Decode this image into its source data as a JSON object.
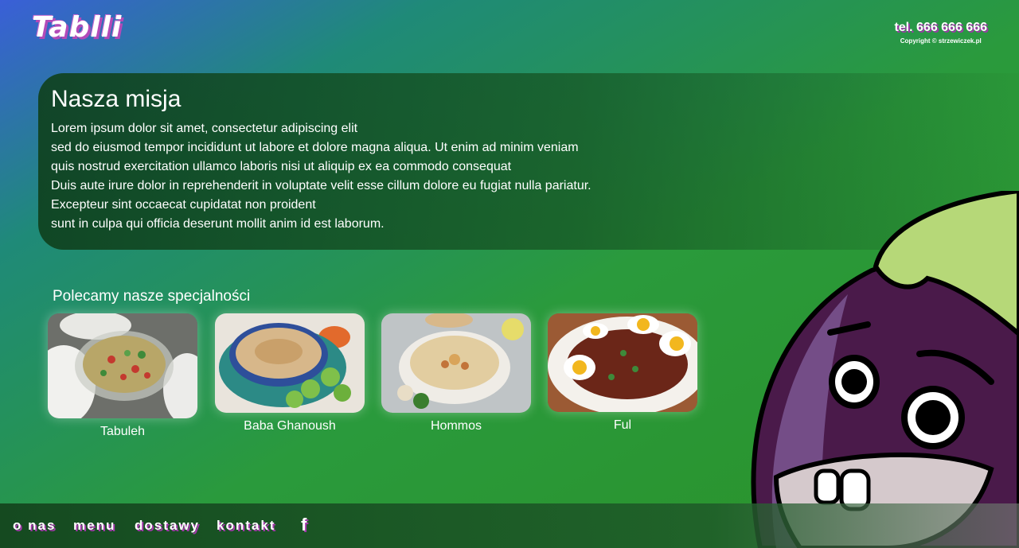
{
  "header": {
    "logo_text": "Tablli",
    "phone": "tel. 666 666 666",
    "copyright": "Copyright © strzewiczek.pl"
  },
  "mission": {
    "title": "Nasza misja",
    "lines": [
      "Lorem ipsum dolor sit amet, consectetur adipiscing elit",
      "sed do eiusmod tempor incididunt ut labore et dolore magna aliqua. Ut enim ad minim veniam",
      "quis nostrud exercitation ullamco laboris nisi ut aliquip ex ea commodo consequat",
      "Duis aute irure dolor in reprehenderit in voluptate velit esse cillum dolore eu fugiat nulla pariatur.",
      "Excepteur sint occaecat cupidatat non proident",
      "sunt in culpa qui officia deserunt mollit anim id est laborum."
    ]
  },
  "specials": {
    "title": "Polecamy nasze specjalności",
    "dishes": [
      {
        "name": "Tabuleh"
      },
      {
        "name": "Baba Ghanoush"
      },
      {
        "name": "Hommos"
      },
      {
        "name": "Ful"
      }
    ]
  },
  "nav": {
    "items": [
      "o nas",
      "menu",
      "dostawy",
      "kontakt"
    ],
    "facebook_icon": "facebook-icon"
  },
  "colors": {
    "accent_shadow": "#a23aaa",
    "eggplant": "#4a1a4a",
    "leaf": "#b6d878"
  }
}
